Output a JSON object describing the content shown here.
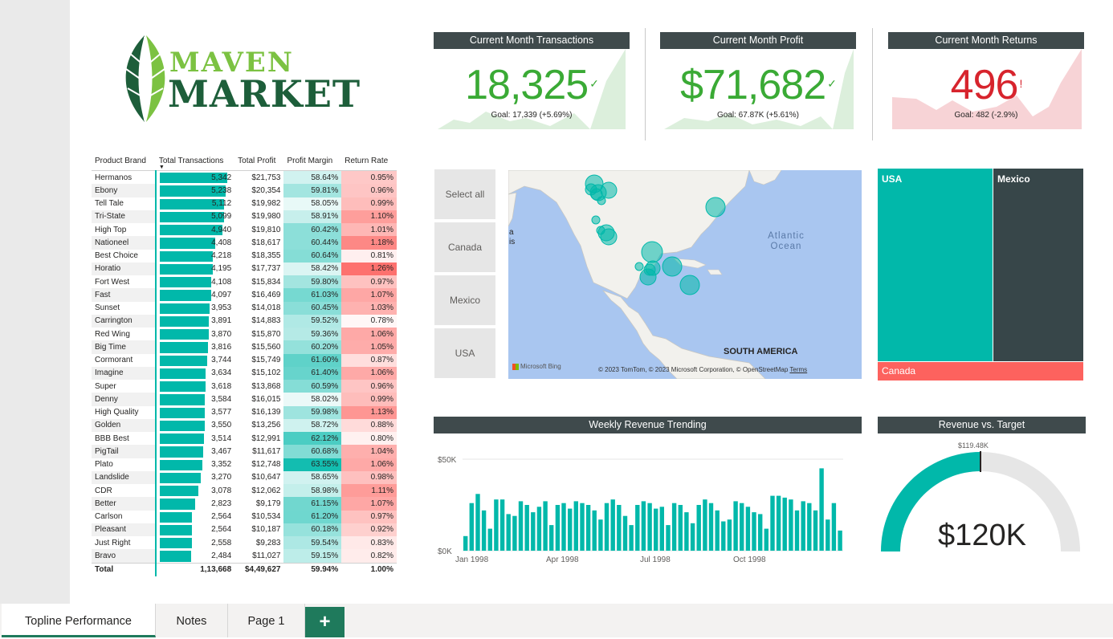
{
  "logo": {
    "line1": "MAVEN",
    "line2": "MARKET"
  },
  "kpis": [
    {
      "title": "Current Month Transactions",
      "value": "18,325",
      "mark": "✓",
      "goal": "Goal: 17,339 (+5.69%)",
      "color": "#3aaa35",
      "fill": "#dcefdc"
    },
    {
      "title": "Current Month Profit",
      "value": "$71,682",
      "mark": "✓",
      "goal": "Goal: 67.87K (+5.61%)",
      "color": "#3aaa35",
      "fill": "#dcefdc"
    },
    {
      "title": "Current Month Returns",
      "value": "496",
      "mark": "!",
      "goal": "Goal: 482 (-2.9%)",
      "color": "#d7242d",
      "fill": "#f7d3d6"
    }
  ],
  "table": {
    "headers": [
      "Product Brand",
      "Total Transactions",
      "Total Profit",
      "Profit Margin",
      "Return Rate"
    ],
    "rows": [
      [
        "Hermanos",
        "5,342",
        "$21,753",
        "58.64%",
        "0.95%"
      ],
      [
        "Ebony",
        "5,238",
        "$20,354",
        "59.81%",
        "0.96%"
      ],
      [
        "Tell Tale",
        "5,112",
        "$19,982",
        "58.05%",
        "0.99%"
      ],
      [
        "Tri-State",
        "5,099",
        "$19,980",
        "58.91%",
        "1.10%"
      ],
      [
        "High Top",
        "4,940",
        "$19,810",
        "60.42%",
        "1.01%"
      ],
      [
        "Nationeel",
        "4,408",
        "$18,617",
        "60.44%",
        "1.18%"
      ],
      [
        "Best Choice",
        "4,218",
        "$18,355",
        "60.64%",
        "0.81%"
      ],
      [
        "Horatio",
        "4,195",
        "$17,737",
        "58.42%",
        "1.26%"
      ],
      [
        "Fort West",
        "4,108",
        "$15,834",
        "59.80%",
        "0.97%"
      ],
      [
        "Fast",
        "4,097",
        "$16,469",
        "61.03%",
        "1.07%"
      ],
      [
        "Sunset",
        "3,953",
        "$14,018",
        "60.45%",
        "1.03%"
      ],
      [
        "Carrington",
        "3,891",
        "$14,883",
        "59.52%",
        "0.78%"
      ],
      [
        "Red Wing",
        "3,870",
        "$15,870",
        "59.36%",
        "1.06%"
      ],
      [
        "Big Time",
        "3,816",
        "$15,560",
        "60.20%",
        "1.05%"
      ],
      [
        "Cormorant",
        "3,744",
        "$15,749",
        "61.60%",
        "0.87%"
      ],
      [
        "Imagine",
        "3,634",
        "$15,102",
        "61.40%",
        "1.06%"
      ],
      [
        "Super",
        "3,618",
        "$13,868",
        "60.59%",
        "0.96%"
      ],
      [
        "Denny",
        "3,584",
        "$16,015",
        "58.02%",
        "0.99%"
      ],
      [
        "High Quality",
        "3,577",
        "$16,139",
        "59.98%",
        "1.13%"
      ],
      [
        "Golden",
        "3,550",
        "$13,256",
        "58.72%",
        "0.88%"
      ],
      [
        "BBB Best",
        "3,514",
        "$12,991",
        "62.12%",
        "0.80%"
      ],
      [
        "PigTail",
        "3,467",
        "$11,617",
        "60.68%",
        "1.04%"
      ],
      [
        "Plato",
        "3,352",
        "$12,748",
        "63.55%",
        "1.06%"
      ],
      [
        "Landslide",
        "3,270",
        "$10,647",
        "58.65%",
        "0.98%"
      ],
      [
        "CDR",
        "3,078",
        "$12,062",
        "58.98%",
        "1.11%"
      ],
      [
        "Better",
        "2,823",
        "$9,179",
        "61.15%",
        "1.07%"
      ],
      [
        "Carlson",
        "2,564",
        "$10,534",
        "61.20%",
        "0.97%"
      ],
      [
        "Pleasant",
        "2,564",
        "$10,187",
        "60.18%",
        "0.92%"
      ],
      [
        "Just Right",
        "2,558",
        "$9,283",
        "59.54%",
        "0.83%"
      ],
      [
        "Bravo",
        "2,484",
        "$11,027",
        "59.15%",
        "0.82%"
      ]
    ],
    "total": [
      "Total",
      "1,13,668",
      "$4,49,627",
      "59.94%",
      "1.00%"
    ]
  },
  "slicer": [
    "Select all",
    "Canada",
    "Mexico",
    "USA"
  ],
  "map": {
    "ocean_label": "Atlantic Ocean",
    "continent_label": "SOUTH AMERICA",
    "brand": "Microsoft Bing",
    "copyright": "© 2023 TomTom, © 2023 Microsoft Corporation, © OpenStreetMap",
    "terms": "Terms",
    "edge_letters": "a\nis"
  },
  "treemap": {
    "items": [
      {
        "label": "USA",
        "color": "#01b8aa"
      },
      {
        "label": "Mexico",
        "color": "#374649"
      },
      {
        "label": "Canada",
        "color": "#fd625e"
      }
    ]
  },
  "weekly": {
    "title": "Weekly Revenue Trending",
    "y_ticks": [
      "$50K",
      "$0K"
    ],
    "x_ticks": [
      "Jan 1998",
      "Apr 1998",
      "Jul 1998",
      "Oct 1998"
    ]
  },
  "chart_data": {
    "type": "bar",
    "title": "Weekly Revenue Trending",
    "x": [
      "Jan 1998",
      "Apr 1998",
      "Jul 1998",
      "Oct 1998"
    ],
    "ylim": [
      0,
      50000
    ],
    "values": [
      8000,
      26000,
      31000,
      22000,
      12000,
      28000,
      28000,
      20000,
      19000,
      27000,
      25000,
      21000,
      24000,
      27000,
      14000,
      25000,
      26000,
      23000,
      27000,
      26000,
      25000,
      22000,
      17000,
      26000,
      28000,
      25000,
      19000,
      14000,
      25000,
      27000,
      26000,
      23000,
      24000,
      14000,
      26000,
      25000,
      21000,
      15000,
      25000,
      28000,
      26000,
      22000,
      16000,
      17000,
      27000,
      26000,
      24000,
      21000,
      20000,
      12000,
      30000,
      30000,
      29000,
      28000,
      22000,
      27000,
      26000,
      22000,
      45000,
      17000,
      26000,
      11000
    ],
    "color": "#01b8aa"
  },
  "gauge": {
    "title": "Revenue vs. Target",
    "target_label": "$119.48K",
    "value_label": "$120K",
    "fraction": 0.5
  },
  "tabs": [
    {
      "label": "Topline Performance"
    },
    {
      "label": "Notes"
    },
    {
      "label": "Page 1"
    }
  ],
  "add_tab": "+"
}
